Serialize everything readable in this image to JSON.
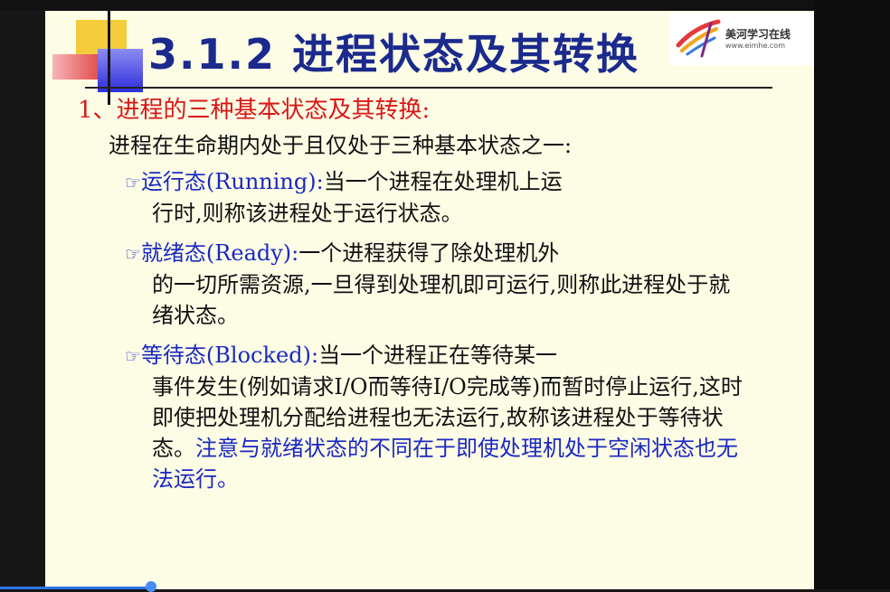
{
  "slide": {
    "title": "3.1.2 进程状态及其转换",
    "logo": {
      "name": "美河学习在线",
      "url": "www.eimhe.com"
    },
    "heading": "1、进程的三种基本状态及其转换:",
    "intro": "进程在生命期内处于且仅处于三种基本状态之一:",
    "bullet_icon": "pointing-hand-icon",
    "states": [
      {
        "name": "运行态(Running):",
        "desc_first": "当一个进程在处理机上运",
        "desc_rest": "行时,则称该进程处于运行状态。",
        "note": ""
      },
      {
        "name": "就绪态(Ready):",
        "desc_first": "一个进程获得了除处理机外",
        "desc_rest": "的一切所需资源,一旦得到处理机即可运行,则称此进程处于就绪状态。",
        "note": ""
      },
      {
        "name": "等待态(Blocked):",
        "desc_first": "当一个进程正在等待某一",
        "desc_rest": "事件发生(例如请求I/O而等待I/O完成等)而暂时停止运行,这时即使把处理机分配给进程也无法运行,故称该进程处于等待状态。",
        "note": "注意与就绪状态的不同在于即使处理机处于空闲状态也无法运行。"
      }
    ]
  },
  "player": {
    "progress": 0.17
  },
  "colors": {
    "title": "#1b2a8c",
    "heading": "#d81818",
    "state_name": "#1a28c0",
    "slide_background": "#fdfde6",
    "progress": "#2d74e8"
  }
}
